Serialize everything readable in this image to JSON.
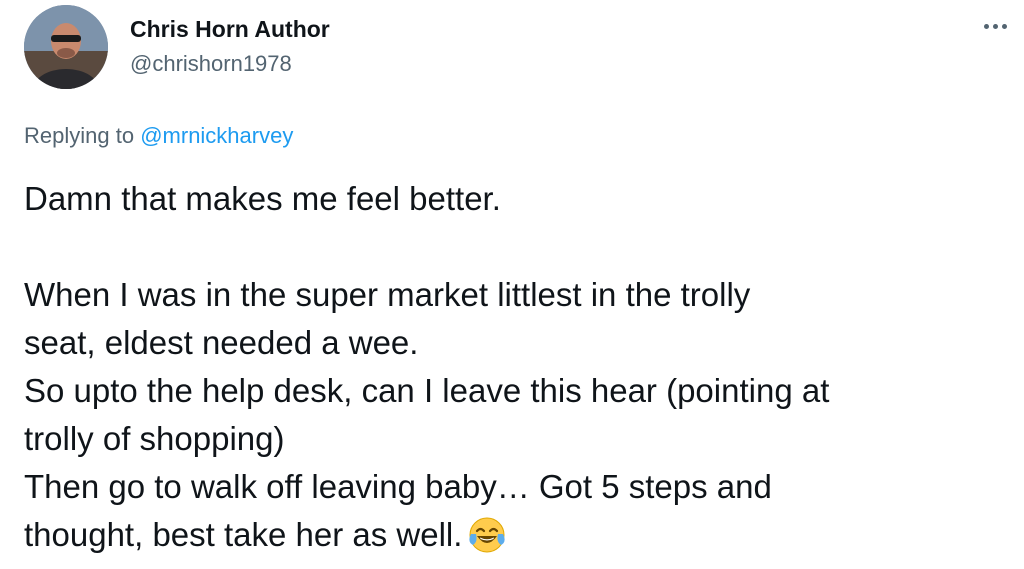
{
  "tweet": {
    "author": {
      "name": "Chris Horn Author",
      "handle": "@chrishorn1978",
      "avatar_icon": "profile-photo"
    },
    "more_icon": "more-options-icon",
    "replying_to": {
      "prefix": "Replying to",
      "handle": "@mrnickharvey"
    },
    "body": {
      "line1": "Damn that makes me feel better.",
      "line2": "When I was in the super market littlest in the trolly",
      "line3": "seat, eldest needed a wee.",
      "line4": "So upto the help desk, can I leave this hear (pointing at",
      "line5": "trolly of shopping)",
      "line6": "Then go to walk off leaving baby… Got 5 steps and",
      "line7": "thought, best take her as well.",
      "emoji": "face-with-tears-of-joy-icon"
    },
    "colors": {
      "text": "#0f1419",
      "secondary": "#536471",
      "link": "#1d9bf0"
    }
  }
}
